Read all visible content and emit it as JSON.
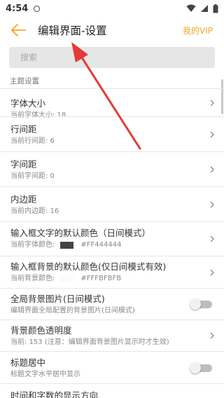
{
  "status_bar": {
    "time": "4:54"
  },
  "header": {
    "title": "编辑界面-设置",
    "vip_label": "我的VIP"
  },
  "search": {
    "placeholder": "搜索"
  },
  "section": {
    "title": "主题设置"
  },
  "settings": [
    {
      "title": "字体大小",
      "subtitle": "当前字体大小: 18"
    },
    {
      "title": "行间距",
      "subtitle": "当前行间距: 6"
    },
    {
      "title": "字间距",
      "subtitle": "当前字间距: 0"
    },
    {
      "title": "内边距",
      "subtitle": "当前内边距: 16"
    },
    {
      "title": "输入框文字的默认颜色（日间模式）",
      "subtitle": "当前字体颜色:",
      "color_hex": "#FF444444",
      "swatch": "#444444"
    },
    {
      "title": "输入框背景的默认颜色(仅日间模式有效)",
      "subtitle": "当前背景颜色:",
      "color_hex": "#FFFBFBFB",
      "swatch": "#FBFBFB"
    },
    {
      "title": "全局背景图片(日间模式)",
      "subtitle": "编辑界面全局配置的背景图片(日间模式)",
      "toggle": false
    },
    {
      "title": "背景颜色透明度",
      "subtitle": "当前: 153 (注意：编辑界面背景图片显示时才生效)"
    },
    {
      "title": "标题居中",
      "subtitle": "标题文字水平居中显示",
      "toggle": false
    },
    {
      "title": "时间和字数的显示方向",
      "subtitle": ""
    }
  ],
  "colors": {
    "accent": "#F5A623",
    "annotation": "#E53935",
    "search_bg": "#E6E6E6",
    "divider": "#E7E7E7"
  }
}
